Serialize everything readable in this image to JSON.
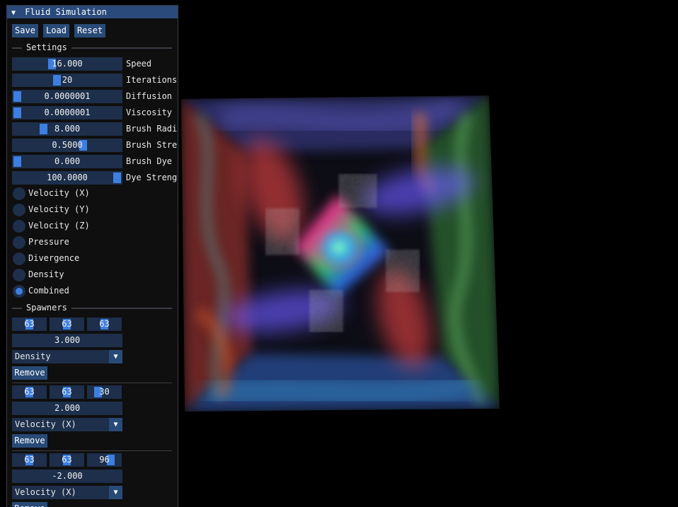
{
  "window": {
    "title": "Fluid Simulation",
    "collapse_icon": "triangle-down"
  },
  "toolbar": {
    "save_label": "Save",
    "load_label": "Load",
    "reset_label": "Reset"
  },
  "settings": {
    "header": "Settings",
    "sliders": [
      {
        "value": "16.000",
        "label": "Speed",
        "fill_fraction": 0.35
      },
      {
        "value": "20",
        "label": "Iterations",
        "fill_fraction": 0.4
      },
      {
        "value": "0.0000001",
        "label": "Diffusion",
        "fill_fraction": 0.0
      },
      {
        "value": "0.0000001",
        "label": "Viscosity",
        "fill_fraction": 0.0
      },
      {
        "value": "8.000",
        "label": "Brush Radius",
        "fill_fraction": 0.26
      },
      {
        "value": "0.5000",
        "label": "Brush Strength",
        "fill_fraction": 0.66
      },
      {
        "value": "0.000",
        "label": "Brush Dye",
        "fill_fraction": 0.0
      },
      {
        "value": "100.0000",
        "label": "Dye Strength",
        "fill_fraction": 1.0
      }
    ],
    "display_modes": [
      {
        "label": "Velocity (X)",
        "selected": false
      },
      {
        "label": "Velocity (Y)",
        "selected": false
      },
      {
        "label": "Velocity (Z)",
        "selected": false
      },
      {
        "label": "Pressure",
        "selected": false
      },
      {
        "label": "Divergence",
        "selected": false
      },
      {
        "label": "Density",
        "selected": false
      },
      {
        "label": "Combined",
        "selected": true
      }
    ]
  },
  "spawners": {
    "header": "Spawners",
    "items": [
      {
        "x": "63",
        "y": "63",
        "z": "63",
        "strength": "3.000",
        "type": "Density",
        "remove_label": "Remove"
      },
      {
        "x": "63",
        "y": "63",
        "z": "30",
        "strength": "2.000",
        "type": "Velocity (X)",
        "remove_label": "Remove"
      },
      {
        "x": "63",
        "y": "63",
        "z": "96",
        "strength": "-2.000",
        "type": "Velocity (X)",
        "remove_label": "Remove"
      }
    ]
  },
  "colors": {
    "title_bg": "#294a7a",
    "frame_bg": "#1d2f4b",
    "button_bg": "#284a77",
    "accent": "#3d7fe0",
    "panel_bg": "#0f0f0f"
  }
}
